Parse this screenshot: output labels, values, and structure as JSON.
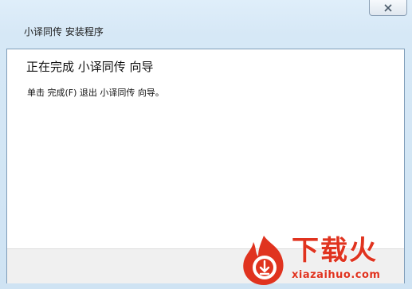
{
  "window": {
    "title": "小译同传 安装程序",
    "close_icon": "close-icon"
  },
  "page": {
    "heading": "正在完成 小译同传 向导",
    "description": "单击 完成(F) 退出 小译同传 向导。"
  },
  "watermark": {
    "brand_cn": "下载火",
    "brand_en": "xiazaihuo.com",
    "logo_icon": "flame-logo-icon",
    "color": "#e0331f"
  }
}
